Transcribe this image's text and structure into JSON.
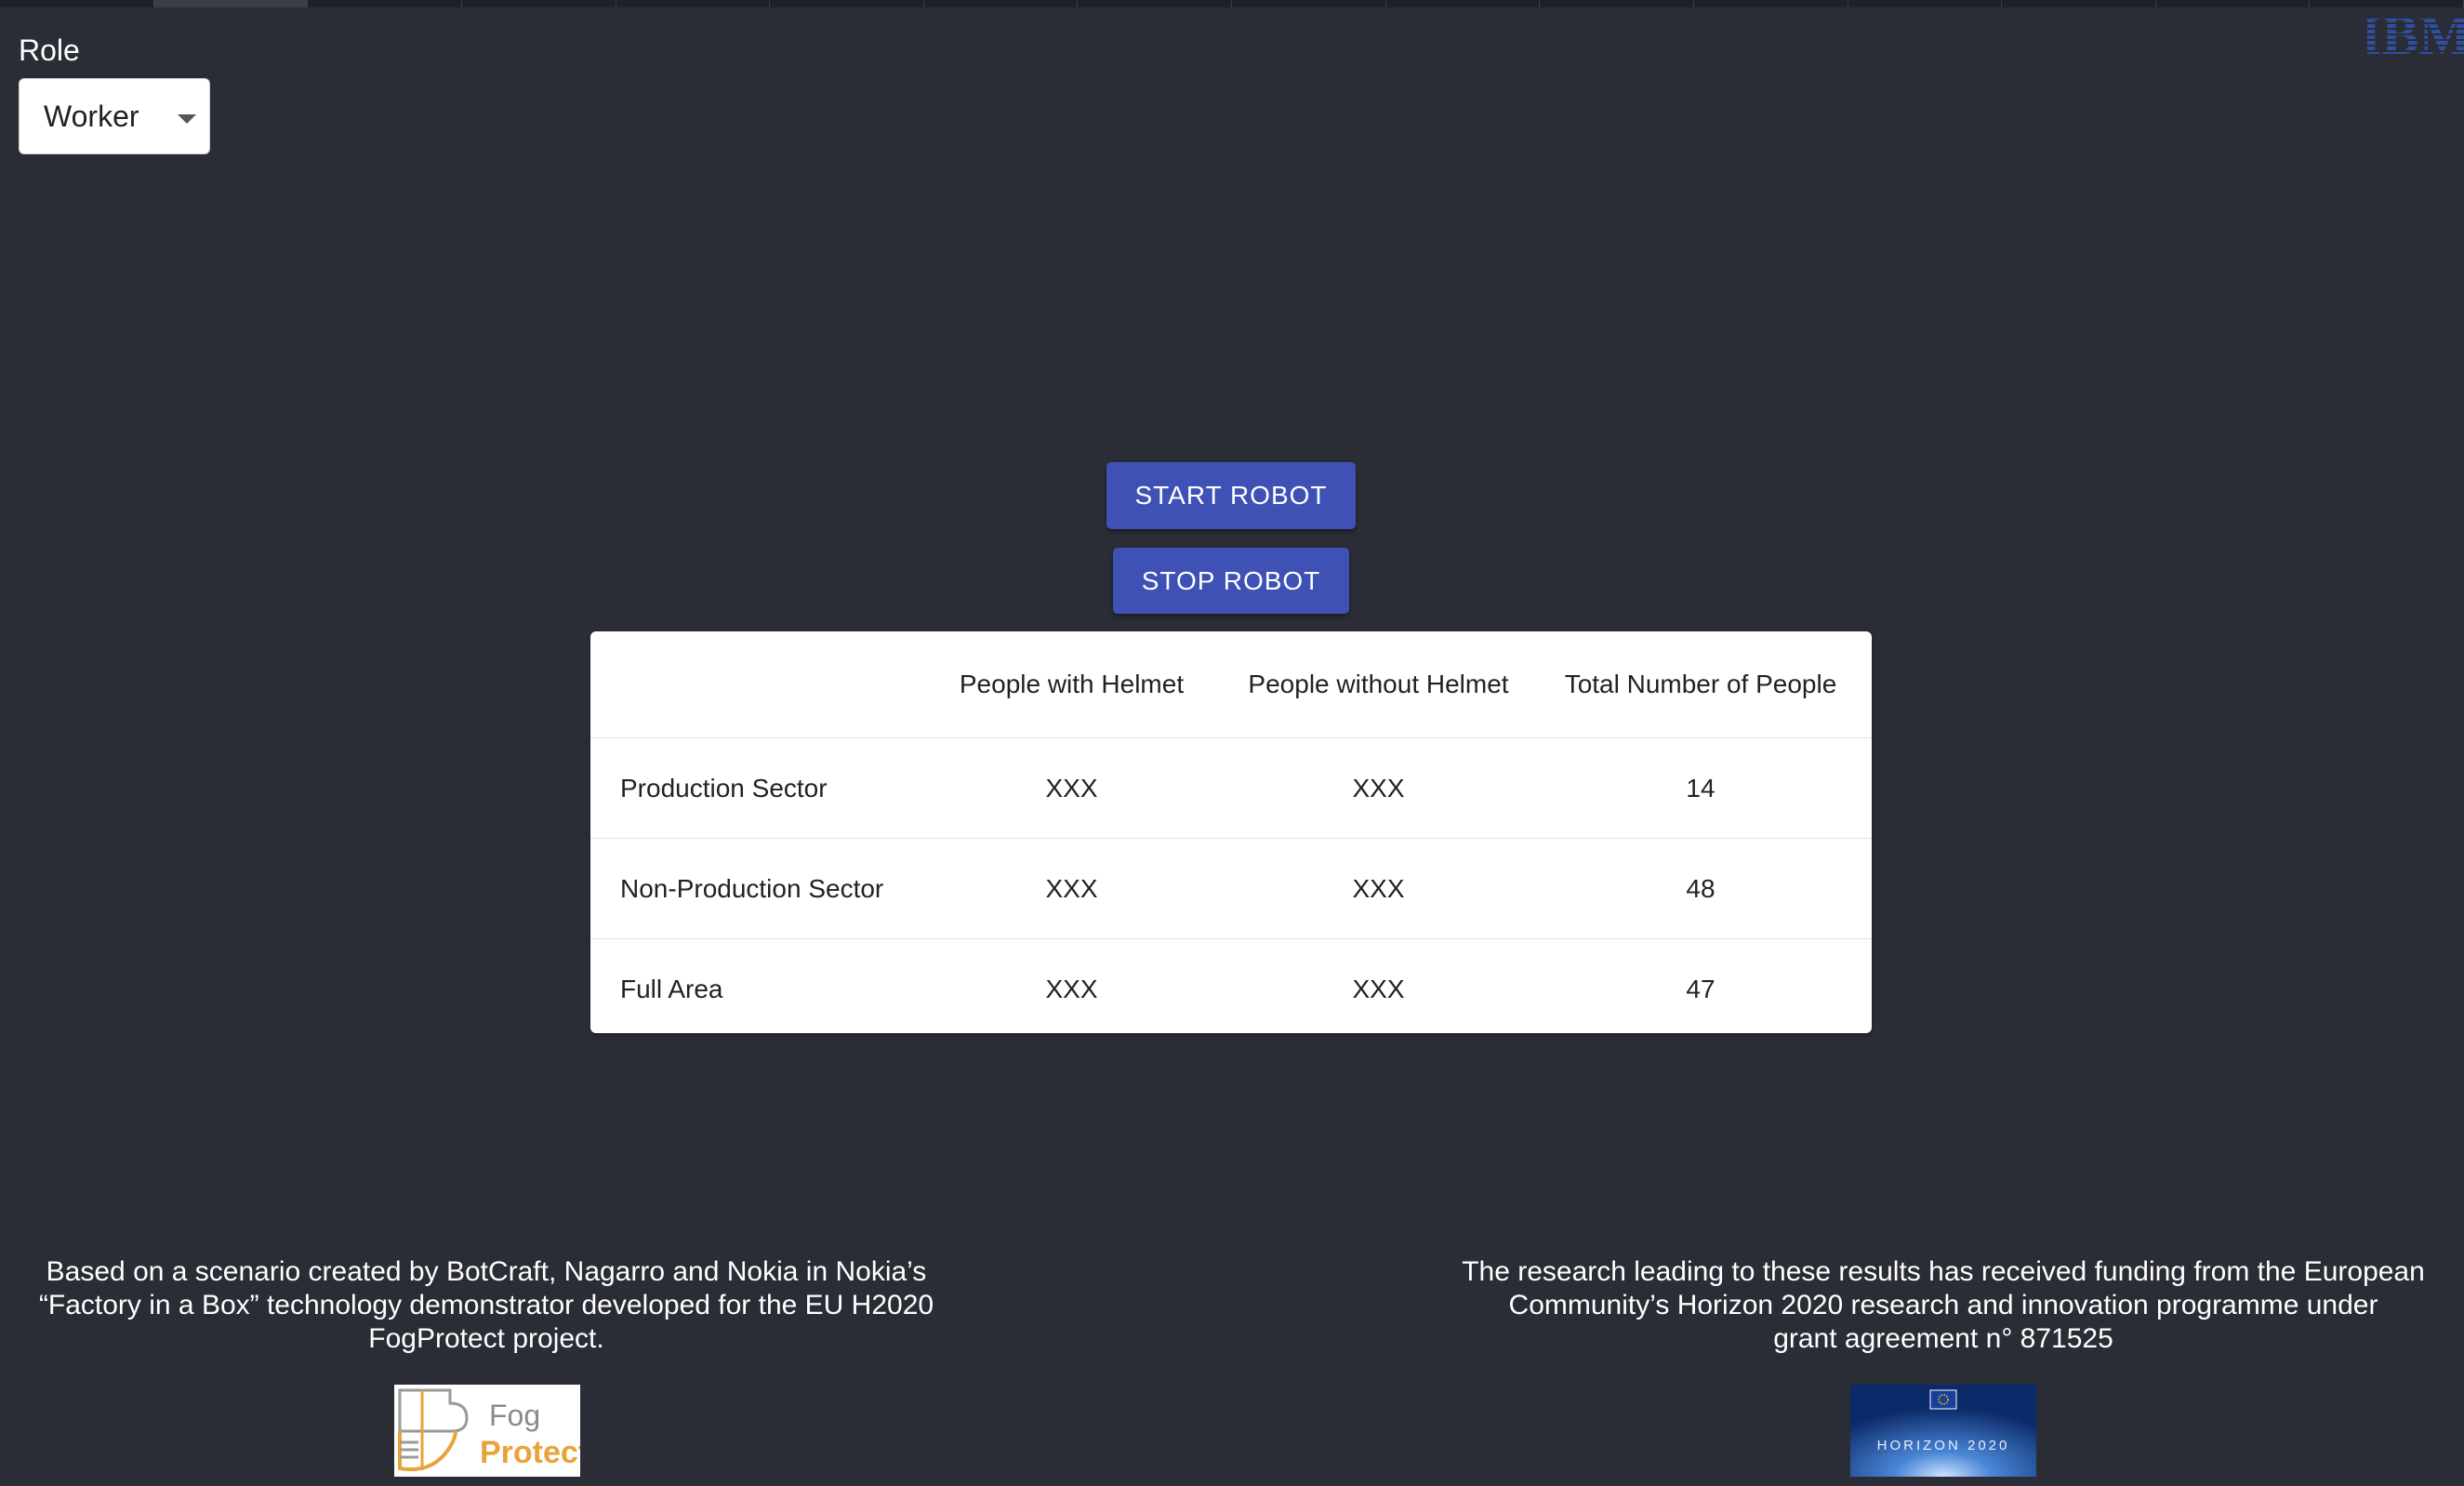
{
  "role": {
    "label": "Role",
    "selected": "Worker"
  },
  "buttons": {
    "start": "START ROBOT",
    "stop": "STOP ROBOT"
  },
  "table": {
    "headers": [
      "",
      "People with Helmet",
      "People without Helmet",
      "Total Number of People"
    ],
    "rows": [
      {
        "label": "Production Sector",
        "with_helmet": "XXX",
        "without_helmet": "XXX",
        "total": "14"
      },
      {
        "label": "Non-Production Sector",
        "with_helmet": "XXX",
        "without_helmet": "XXX",
        "total": "48"
      },
      {
        "label": "Full Area",
        "with_helmet": "XXX",
        "without_helmet": "XXX",
        "total": "47"
      }
    ]
  },
  "footer": {
    "left_lines": [
      "Based on a scenario created by BotCraft, Nagarro and Nokia in Nokia’s",
      "“Factory in a Box” technology demonstrator developed for the EU H2020",
      "FogProtect project."
    ],
    "right_lines": [
      "The research leading to these results has received funding from the European",
      "Community’s Horizon 2020 research and innovation programme under",
      "grant agreement n° 871525"
    ]
  },
  "logos": {
    "ibm": "IBM",
    "fog_line1": "Fog",
    "fog_line2": "Protect",
    "horizon": "HORIZON 2020"
  },
  "colors": {
    "background": "#2a2d35",
    "button": "#3f51b5",
    "fog_orange": "#e8a33a"
  }
}
